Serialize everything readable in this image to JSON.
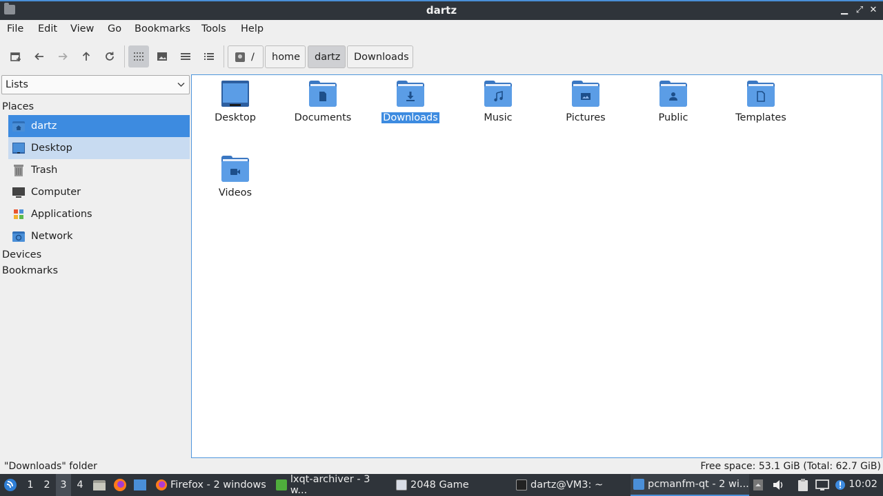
{
  "window": {
    "title": "dartz"
  },
  "menu": [
    "File",
    "Edit",
    "View",
    "Go",
    "Bookmarks",
    "Tools",
    "Help"
  ],
  "toolbar": {
    "buttons": [
      "new-tab-icon",
      "back-icon",
      "forward-icon",
      "up-icon",
      "reload-icon",
      "icon-view-icon",
      "thumbnail-view-icon",
      "compact-view-icon",
      "detailed-list-icon"
    ],
    "breadcrumb": [
      "/",
      "home",
      "dartz",
      "Downloads"
    ]
  },
  "sidepane": {
    "mode": "Lists",
    "places_header": "Places",
    "places": [
      "dartz",
      "Desktop",
      "Trash",
      "Computer",
      "Applications",
      "Network"
    ],
    "devices_header": "Devices",
    "bookmarks_header": "Bookmarks"
  },
  "files": [
    "Desktop",
    "Documents",
    "Downloads",
    "Music",
    "Pictures",
    "Public",
    "Templates",
    "Videos"
  ],
  "status": {
    "selection": "\"Downloads\" folder",
    "free_space": "Free space: 53.1 GiB (Total: 62.7 GiB)"
  },
  "taskbar": {
    "desktops": [
      "1",
      "2",
      "3",
      "4"
    ],
    "tasks": [
      "Firefox - 2 windows",
      "lxqt-archiver - 3 w...",
      "2048 Game",
      "dartz@VM3: ~",
      "pcmanfm-qt - 2 wi..."
    ],
    "clock": "10:02"
  },
  "colors": {
    "accent": "#3d8be0",
    "folder": "#5b9de6",
    "folder_dark": "#3a77c2",
    "panel": "#2f343a"
  }
}
